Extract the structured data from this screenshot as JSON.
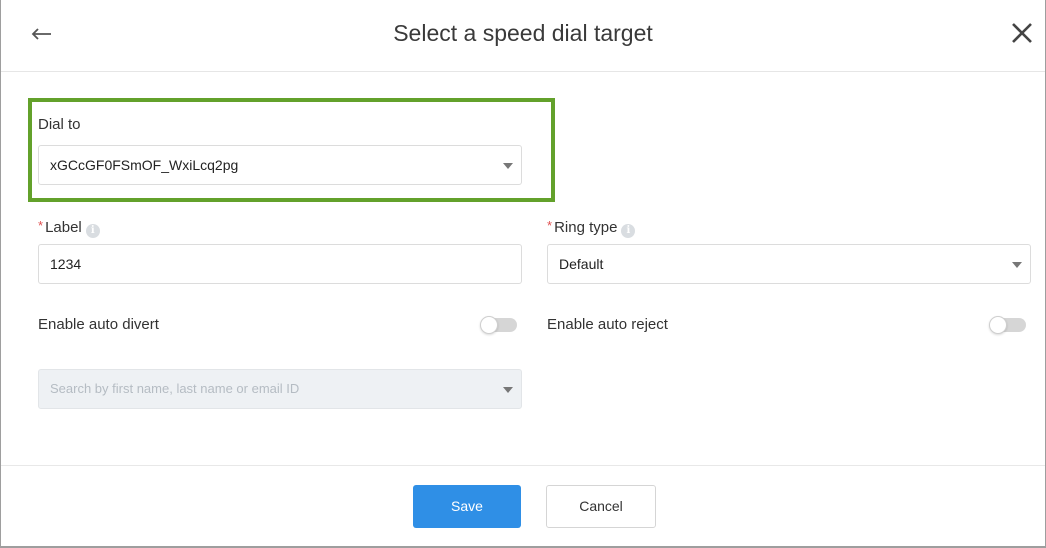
{
  "dialog": {
    "title": "Select a speed dial target",
    "back_icon": "arrow-left-icon",
    "close_icon": "close-icon"
  },
  "dial_to": {
    "label": "Dial to",
    "value": "xGCcGF0FSmOF_WxiLcq2pg",
    "highlight_color": "#63a12b"
  },
  "label_field": {
    "label": "Label",
    "required_mark": "*",
    "info_icon": "i",
    "value": "1234"
  },
  "ring_type": {
    "label": "Ring type",
    "required_mark": "*",
    "info_icon": "i",
    "value": "Default"
  },
  "auto_divert": {
    "label": "Enable auto divert",
    "enabled": false
  },
  "auto_reject": {
    "label": "Enable auto reject",
    "enabled": false
  },
  "search": {
    "placeholder": "Search by first name, last name or email ID"
  },
  "footer": {
    "save_label": "Save",
    "cancel_label": "Cancel",
    "save_color": "#2f8fe6"
  }
}
